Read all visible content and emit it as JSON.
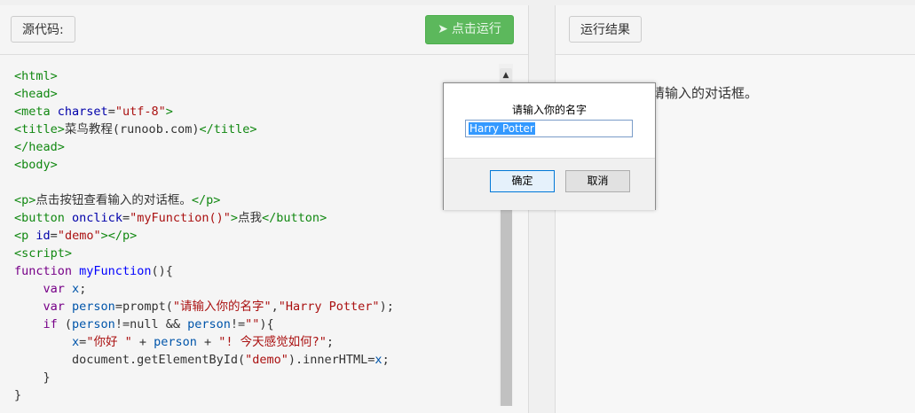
{
  "left_panel": {
    "source_label": "源代码:",
    "run_label": "点击运行",
    "run_icon": "paper-plane-icon"
  },
  "right_panel": {
    "result_label": "运行结果",
    "result_text": "请输入的对话框。"
  },
  "code_lines": [
    "<html>",
    "<head>",
    "<meta charset=\"utf-8\">",
    "<title>菜鸟教程(runoob.com)</title>",
    "</head>",
    "<body>",
    "",
    "<p>点击按钮查看输入的对话框。</p>",
    "<button onclick=\"myFunction()\">点我</button>",
    "<p id=\"demo\"></p>",
    "<script>",
    "function myFunction(){",
    "    var x;",
    "    var person=prompt(\"请输入你的名字\",\"Harry Potter\");",
    "    if (person!=null && person!=\"\"){",
    "        x=\"你好 \" + person + \"! 今天感觉如何?\";",
    "        document.getElementById(\"demo\").innerHTML=x;",
    "    }",
    "}"
  ],
  "dialog": {
    "message": "请输入你的名字",
    "input_value": "Harry Potter",
    "ok_label": "确定",
    "cancel_label": "取消"
  },
  "colors": {
    "run_button": "#5cb85c",
    "selection": "#3399ff",
    "html_tag": "#118811",
    "string": "#aa1111"
  }
}
